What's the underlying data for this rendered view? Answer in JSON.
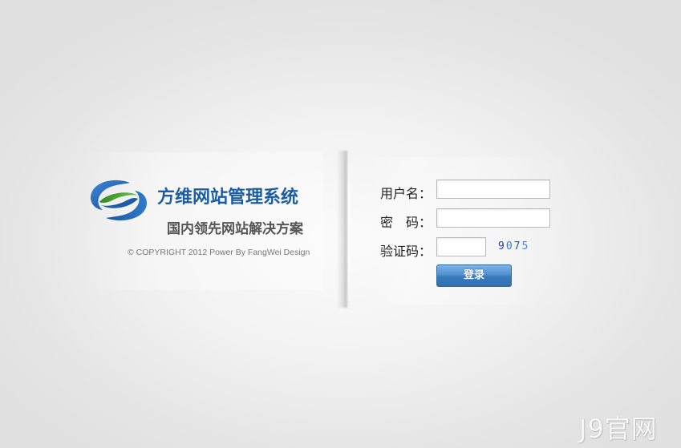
{
  "brand": {
    "title": "方维网站管理系统",
    "subtitle": "国内领先网站解决方案",
    "copyright": "© COPYRIGHT 2012 Power By FangWei Design",
    "logo_icon": "fangwei-logo-icon",
    "colors": {
      "title": "#1a5da3",
      "logo_blue": "#1f63b3",
      "logo_green": "#3a9a2e"
    }
  },
  "login_form": {
    "username_label": "用户名：",
    "username_value": "",
    "password_label": "密　码：",
    "password_value": "",
    "captcha_label": "验证码：",
    "captcha_value": "",
    "captcha_image_text": [
      "9",
      "0",
      "7",
      "5"
    ],
    "submit_label": "登录",
    "colors": {
      "button": "#3a7bbd"
    }
  },
  "watermark": {
    "text": "J9官网"
  }
}
